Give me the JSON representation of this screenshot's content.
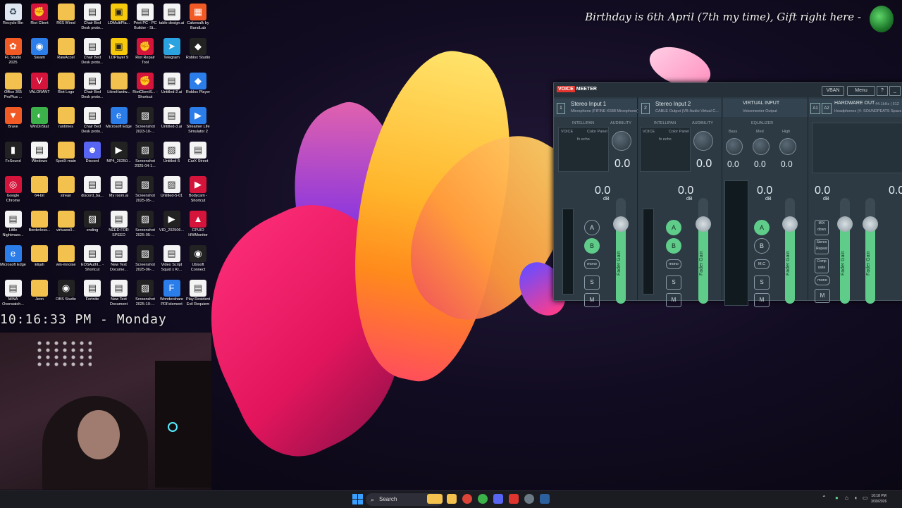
{
  "banner": {
    "text": "Birthday is 6th April (7th my time), Gift right here -"
  },
  "clock_overlay": {
    "text": "10:16:33 PM - Monday"
  },
  "desktop_icons": [
    {
      "label": "Recycle Bin",
      "icon": "recycle-bin-icon",
      "cls": "c-recycle",
      "glyph": "♻"
    },
    {
      "label": "Riot Client",
      "icon": "riot-client-icon",
      "cls": "c-red",
      "glyph": "✊"
    },
    {
      "label": "R6S Wired",
      "icon": "folder-icon",
      "cls": "c-folder",
      "glyph": ""
    },
    {
      "label": "Chair Bed Desk proto...",
      "icon": "document-icon",
      "cls": "c-doc",
      "glyph": "▤"
    },
    {
      "label": "LDMultiPla...",
      "icon": "ldmultiplayer-icon",
      "cls": "c-yellow",
      "glyph": "▣"
    },
    {
      "label": "Print PC - PC Builder - St...",
      "icon": "document-icon",
      "cls": "c-doc",
      "glyph": "▤"
    },
    {
      "label": "table design.ai",
      "icon": "document-icon",
      "cls": "c-doc",
      "glyph": "▤"
    },
    {
      "label": "Cakewalk by BandLab",
      "icon": "cakewalk-icon",
      "cls": "c-orange",
      "glyph": "▦"
    },
    {
      "label": "FL Studio 2025",
      "icon": "fl-studio-icon",
      "cls": "c-orange",
      "glyph": "✿"
    },
    {
      "label": "Steam",
      "icon": "steam-icon",
      "cls": "c-blue",
      "glyph": "◉"
    },
    {
      "label": "RawAccel",
      "icon": "folder-icon",
      "cls": "c-folder",
      "glyph": ""
    },
    {
      "label": "Chair Bed Desk proto...",
      "icon": "document-icon",
      "cls": "c-doc",
      "glyph": "▤"
    },
    {
      "label": "LDPlayer 9",
      "icon": "ldplayer-icon",
      "cls": "c-yellow",
      "glyph": "▣"
    },
    {
      "label": "Riot Repair Tool",
      "icon": "riot-repair-icon",
      "cls": "c-red",
      "glyph": "✊"
    },
    {
      "label": "Telegram",
      "icon": "telegram-icon",
      "cls": "c-tele",
      "glyph": "➤"
    },
    {
      "label": "Roblox Studio",
      "icon": "roblox-studio-icon",
      "cls": "c-dark",
      "glyph": "◆"
    },
    {
      "label": "Office 365 ProPlus ...",
      "icon": "folder-icon",
      "cls": "c-folder",
      "glyph": ""
    },
    {
      "label": "VALORANT",
      "icon": "valorant-icon",
      "cls": "c-red",
      "glyph": "V"
    },
    {
      "label": "Riot Logs",
      "icon": "folder-icon",
      "cls": "c-folder",
      "glyph": ""
    },
    {
      "label": "Chair Bed Desk proto...",
      "icon": "document-icon",
      "cls": "c-doc",
      "glyph": "▤"
    },
    {
      "label": "LibreHardw...",
      "icon": "folder-icon",
      "cls": "c-folder",
      "glyph": ""
    },
    {
      "label": "RiotClientS... - Shortcut",
      "icon": "riot-client-icon",
      "cls": "c-red",
      "glyph": "✊"
    },
    {
      "label": "Untitled-2.ai",
      "icon": "document-icon",
      "cls": "c-doc",
      "glyph": "▤"
    },
    {
      "label": "Roblox Player",
      "icon": "roblox-player-icon",
      "cls": "c-blue",
      "glyph": "◆"
    },
    {
      "label": "Brave",
      "icon": "brave-icon",
      "cls": "c-orange",
      "glyph": "▼"
    },
    {
      "label": "WinDirStat",
      "icon": "windirstat-icon",
      "cls": "c-green",
      "glyph": "◐"
    },
    {
      "label": "runtimes",
      "icon": "folder-icon",
      "cls": "c-folder",
      "glyph": ""
    },
    {
      "label": "Chair Bed Desk proto...",
      "icon": "document-icon",
      "cls": "c-doc",
      "glyph": "▤"
    },
    {
      "label": "Microsoft Edge",
      "icon": "edge-icon",
      "cls": "c-blue",
      "glyph": "e"
    },
    {
      "label": "Screenshot 2023-10-...",
      "icon": "image-icon",
      "cls": "c-dark",
      "glyph": "▨"
    },
    {
      "label": "Untitled-3.ai",
      "icon": "document-icon",
      "cls": "c-doc",
      "glyph": "▤"
    },
    {
      "label": "Streamer Life Simulator 2",
      "icon": "game-icon",
      "cls": "c-blue",
      "glyph": "▶"
    },
    {
      "label": "FxSound",
      "icon": "fxsound-icon",
      "cls": "c-dark",
      "glyph": "▮"
    },
    {
      "label": "Windows",
      "icon": "document-icon",
      "cls": "c-doc",
      "glyph": "▤"
    },
    {
      "label": "SpotX-main",
      "icon": "folder-icon",
      "cls": "c-folder",
      "glyph": ""
    },
    {
      "label": "Discord",
      "icon": "discord-icon",
      "cls": "c-purple",
      "glyph": "☻"
    },
    {
      "label": "MP4_20250...",
      "icon": "video-icon",
      "cls": "c-dark",
      "glyph": "▶"
    },
    {
      "label": "Screenshot 2025-04-1...",
      "icon": "image-icon",
      "cls": "c-dark",
      "glyph": "▨"
    },
    {
      "label": "Untitled-5",
      "icon": "image-icon",
      "cls": "c-doc",
      "glyph": "▨"
    },
    {
      "label": "CarX Street",
      "icon": "document-icon",
      "cls": "c-doc",
      "glyph": "▤"
    },
    {
      "label": "Google Chrome",
      "icon": "chrome-icon",
      "cls": "c-red",
      "glyph": "◎"
    },
    {
      "label": "64-bit",
      "icon": "folder-icon",
      "cls": "c-folder",
      "glyph": ""
    },
    {
      "label": "strean",
      "icon": "folder-icon",
      "cls": "c-folder",
      "glyph": ""
    },
    {
      "label": "discord_ba...",
      "icon": "document-icon",
      "cls": "c-doc",
      "glyph": "▤"
    },
    {
      "label": "My room.ai",
      "icon": "document-icon",
      "cls": "c-doc",
      "glyph": "▤"
    },
    {
      "label": "Screenshot 2025-05-...",
      "icon": "image-icon",
      "cls": "c-dark",
      "glyph": "▨"
    },
    {
      "label": "Untitled-5-01",
      "icon": "image-icon",
      "cls": "c-doc",
      "glyph": "▨"
    },
    {
      "label": "Bodycam - Shortcut",
      "icon": "game-icon",
      "cls": "c-red",
      "glyph": "▶"
    },
    {
      "label": "Little Nightmare...",
      "icon": "document-icon",
      "cls": "c-doc",
      "glyph": "▤"
    },
    {
      "label": "Borderless...",
      "icon": "folder-icon",
      "cls": "c-folder",
      "glyph": ""
    },
    {
      "label": "virtuaos0...",
      "icon": "folder-icon",
      "cls": "c-folder",
      "glyph": ""
    },
    {
      "label": "ending",
      "icon": "image-icon",
      "cls": "c-dark",
      "glyph": "▨"
    },
    {
      "label": "NEED FOR SPEED",
      "icon": "document-icon",
      "cls": "c-doc",
      "glyph": "▤"
    },
    {
      "label": "Screenshot 2025-05-...",
      "icon": "image-icon",
      "cls": "c-dark",
      "glyph": "▨"
    },
    {
      "label": "VID_202506...",
      "icon": "video-icon",
      "cls": "c-dark",
      "glyph": "▶"
    },
    {
      "label": "CPUID HWMonitor",
      "icon": "hwmonitor-icon",
      "cls": "c-red",
      "glyph": "▲"
    },
    {
      "label": "Microsoft Edge",
      "icon": "edge-icon",
      "cls": "c-blue",
      "glyph": "e"
    },
    {
      "label": "Elijah",
      "icon": "folder-icon",
      "cls": "c-folder",
      "glyph": ""
    },
    {
      "label": "win-mnoise",
      "icon": "folder-icon",
      "cls": "c-folder",
      "glyph": ""
    },
    {
      "label": "EOSAuthl... - Shortcut",
      "icon": "document-icon",
      "cls": "c-doc",
      "glyph": "▤"
    },
    {
      "label": "New Text Docume...",
      "icon": "document-icon",
      "cls": "c-doc",
      "glyph": "▤"
    },
    {
      "label": "Screenshot 2025-06-...",
      "icon": "image-icon",
      "cls": "c-dark",
      "glyph": "▨"
    },
    {
      "label": "Video Script Squid x Kr...",
      "icon": "document-icon",
      "cls": "c-doc",
      "glyph": "▤"
    },
    {
      "label": "Ubisoft Connect",
      "icon": "ubisoft-icon",
      "cls": "c-dark",
      "glyph": "◉"
    },
    {
      "label": "MINA Overwatch...",
      "icon": "document-icon",
      "cls": "c-doc",
      "glyph": "▤"
    },
    {
      "label": "Jeon",
      "icon": "folder-icon",
      "cls": "c-folder",
      "glyph": ""
    },
    {
      "label": "OBS Studio",
      "icon": "obs-icon",
      "cls": "c-dark",
      "glyph": "◉"
    },
    {
      "label": "Fortnite",
      "icon": "document-icon",
      "cls": "c-doc",
      "glyph": "▤"
    },
    {
      "label": "New Text Document",
      "icon": "document-icon",
      "cls": "c-doc",
      "glyph": "▤"
    },
    {
      "label": "Screenshot 2025-10-...",
      "icon": "image-icon",
      "cls": "c-dark",
      "glyph": "▨"
    },
    {
      "label": "Wondershare PDFelement",
      "icon": "pdfelement-icon",
      "cls": "c-blue",
      "glyph": "F"
    },
    {
      "label": "Play Resident Evil Requiem",
      "icon": "game-icon",
      "cls": "c-doc",
      "glyph": "▤"
    }
  ],
  "voicemeeter": {
    "logo_voice": "VOICE",
    "logo_meeter": "MEETER",
    "vban": "VBAN",
    "menu": "Menu",
    "help": "?",
    "minimize": "_",
    "strips": [
      {
        "num": "1",
        "title": "Stereo Input 1",
        "sub": "Microphone (FIFINE K688 Microphone)",
        "intellipan": "INTELLIPAN",
        "audibility": "AUDIBILITY",
        "voice": "VOICE",
        "color_panel": "Color Panel",
        "fx_echo": "fx echo",
        "gain": "0.0",
        "fader_gain": "0.0",
        "db": "dB",
        "a": "A",
        "b": "B",
        "mono": "mono",
        "solo": "S",
        "mute": "M",
        "fader_label": "Fader Gain"
      },
      {
        "num": "2",
        "title": "Stereo Input 2",
        "sub": "CABLE Output (VB-Audio Virtual C...",
        "intellipan": "INTELLIPAN",
        "audibility": "AUDIBILITY",
        "voice": "VOICE",
        "color_panel": "Color Panel",
        "fx_echo": "fx echo",
        "gain": "0.0",
        "fader_gain": "0.0",
        "db": "dB",
        "a": "A",
        "b": "B",
        "mono": "mono",
        "solo": "S",
        "mute": "M",
        "fader_label": "Fader Gain"
      }
    ],
    "virtual": {
      "title": "VIRTUAL INPUT",
      "sub": "Voicemeeter Output",
      "equalizer": "EQUALIZER",
      "bass": "Bass",
      "med": "Med",
      "high": "High",
      "bass_val": "0.0",
      "med_val": "0.0",
      "high_val": "0.0",
      "fader_gain": "0.0",
      "db": "dB",
      "a": "A",
      "b": "B",
      "mc": "M.C",
      "solo": "S",
      "mute": "M",
      "fader_label": "Fader Gain"
    },
    "hardware": {
      "a1": "A1",
      "a2": "A2",
      "title": "HARDWARE OUT",
      "rate": "44.1kHz | 512",
      "sub": "Headphones (4- SOUNDPEATS Space P...",
      "gain1": "0.0",
      "gain2": "0.0",
      "db": "dB",
      "mix": "MIX",
      "down": "down",
      "stereo_repeat": "Stereo Repeat",
      "composite": "Comp osite",
      "mono": "mono",
      "mute": "M",
      "fader_label": "Fader Gain"
    }
  },
  "taskbar": {
    "search_placeholder": "Search",
    "time": "10:18 PM",
    "date": "3/30/2026"
  }
}
